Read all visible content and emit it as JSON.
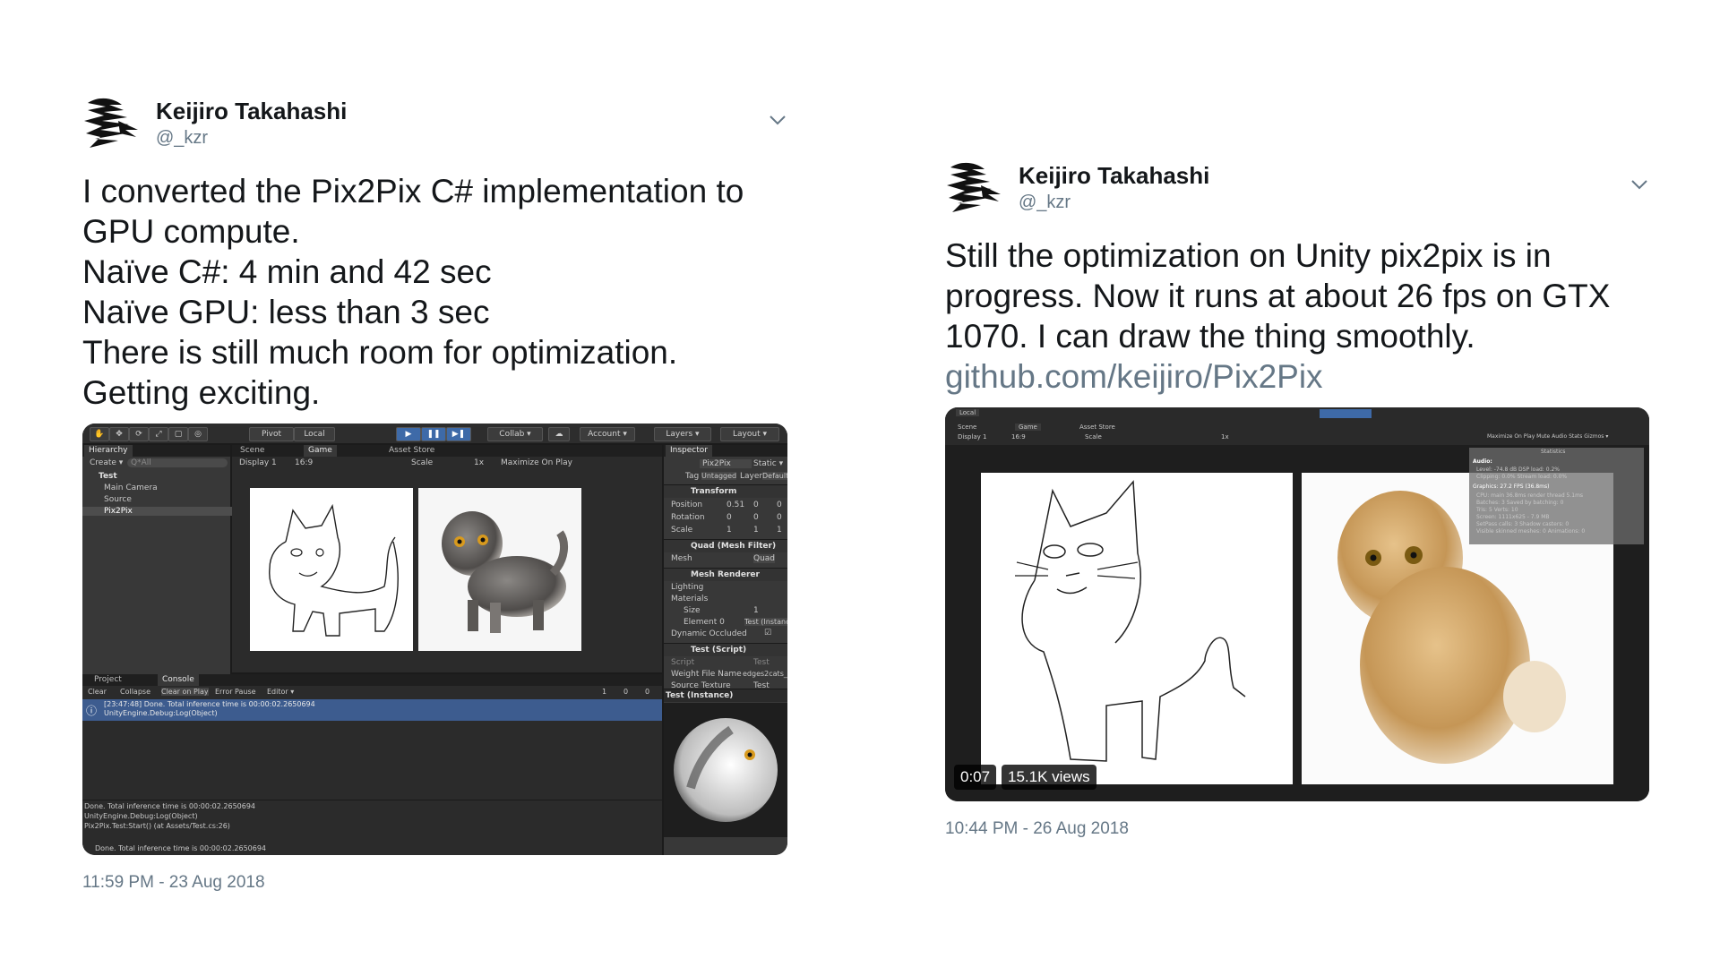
{
  "tweets": [
    {
      "author_name": "Keijiro Takahashi",
      "author_handle": "@_kzr",
      "lines": [
        "I converted the Pix2Pix C# implementation to",
        "GPU compute.",
        "Naïve C#: 4 min and 42 sec",
        "Naïve GPU: less than 3 sec",
        "There is still much room for optimization.",
        "Getting exciting."
      ],
      "timestamp": "11:59 PM - 23 Aug 2018",
      "media": {
        "toolbar": {
          "pivot": "Pivot",
          "local": "Local",
          "collab": "Collab ▾",
          "account": "Account ▾",
          "layers": "Layers ▾",
          "layout": "Layout ▾"
        },
        "hierarchy": {
          "tab": "Hierarchy",
          "create": "Create ▾",
          "search": "Q*All",
          "scene": "Test",
          "items": [
            "Main Camera",
            "Source",
            "Pix2Pix"
          ]
        },
        "scene_tabs": [
          "Scene",
          "Game",
          "Asset Store"
        ],
        "game_bar": {
          "display": "Display 1",
          "aspect": "16:9",
          "scale": "Scale",
          "scale_value": "1x",
          "maximize": "Maximize On Play"
        },
        "inspector": {
          "tab": "Inspector",
          "object_name": "Pix2Pix",
          "static": "Static ▾",
          "tag_label": "Tag",
          "tag_value": "Untagged",
          "layer_label": "Layer",
          "layer_value": "Default",
          "transform": "Transform",
          "position": {
            "label": "Position",
            "x": "0.51",
            "y": "0",
            "z": "0"
          },
          "rotation": {
            "label": "Rotation",
            "x": "0",
            "y": "0",
            "z": "0"
          },
          "scale": {
            "label": "Scale",
            "x": "1",
            "y": "1",
            "z": "1"
          },
          "mesh_filter": "Quad (Mesh Filter)",
          "mesh_label": "Mesh",
          "mesh_value": "Quad",
          "mesh_renderer": "Mesh Renderer",
          "lighting": "Lighting",
          "materials": "Materials",
          "size_label": "Size",
          "size_value": "1",
          "element_label": "Element 0",
          "element_value": "Test (Instance)",
          "occluded": "Dynamic Occluded",
          "script_comp": "Test (Script)",
          "script_label": "Script",
          "script_value": "Test",
          "weight_label": "Weight File Name",
          "weight_value": "edges2cats_AtoB.pi",
          "source_label": "Source Texture",
          "source_value": "Test",
          "preview_title": "Test (Instance)"
        },
        "console": {
          "tabs": [
            "Project",
            "Console"
          ],
          "buttons": [
            "Clear",
            "Collapse",
            "Clear on Play",
            "Error Pause",
            "Editor ▾"
          ],
          "counts": [
            "1",
            "0",
            "0"
          ],
          "entry_line1": "[23:47:48] Done. Total inference time is 00:00:02.2650694",
          "entry_line2": "UnityEngine.Debug:Log(Object)",
          "detail": [
            "Done. Total inference time is 00:00:02.2650694",
            "UnityEngine.Debug:Log(Object)",
            "Pix2Pix.Test:Start() (at Assets/Test.cs:26)"
          ],
          "status": "Done. Total inference time is 00:00:02.2650694"
        }
      }
    },
    {
      "author_name": "Keijiro Takahashi",
      "author_handle": "@_kzr",
      "lines": [
        "Still the optimization on Unity pix2pix is in",
        "progress. Now it runs at about 26 fps on GTX",
        "1070. I can draw the thing smoothly."
      ],
      "link": "github.com/keijiro/Pix2Pix",
      "timestamp": "10:44 PM - 26 Aug 2018",
      "media": {
        "local": "Local",
        "tabs": [
          "Scene",
          "Game",
          "Asset Store"
        ],
        "game_bar": {
          "display": "Display 1",
          "aspect": "16:9",
          "scale": "Scale",
          "scale_value": "1x",
          "right": "Maximize On Play  Mute Audio  Stats  Gizmos ▾"
        },
        "stats": {
          "title": "Statistics",
          "audio": "Audio:",
          "audio_lines": [
            "Level: -74.8 dB    DSP load: 0.2%",
            "Clipping: 0.0%    Stream load: 0.0%"
          ],
          "graphics": "Graphics:    27.2 FPS (36.8ms)",
          "graphics_lines": [
            "CPU: main 36.8ms  render thread 5.1ms",
            "Batches: 3     Saved by batching: 0",
            "Tris: 5    Verts: 10",
            "Screen: 1111x625 - 7.9 MB",
            "SetPass calls: 3    Shadow casters: 0",
            "Visible skinned meshes: 0   Animations: 0"
          ]
        },
        "duration": "0:07",
        "views": "15.1K views"
      }
    }
  ],
  "colors": {
    "text": "#14171a",
    "muted": "#657786",
    "unity_bg": "#1b1b1b",
    "unity_panel": "#383838",
    "selection": "#3d5c8f"
  }
}
